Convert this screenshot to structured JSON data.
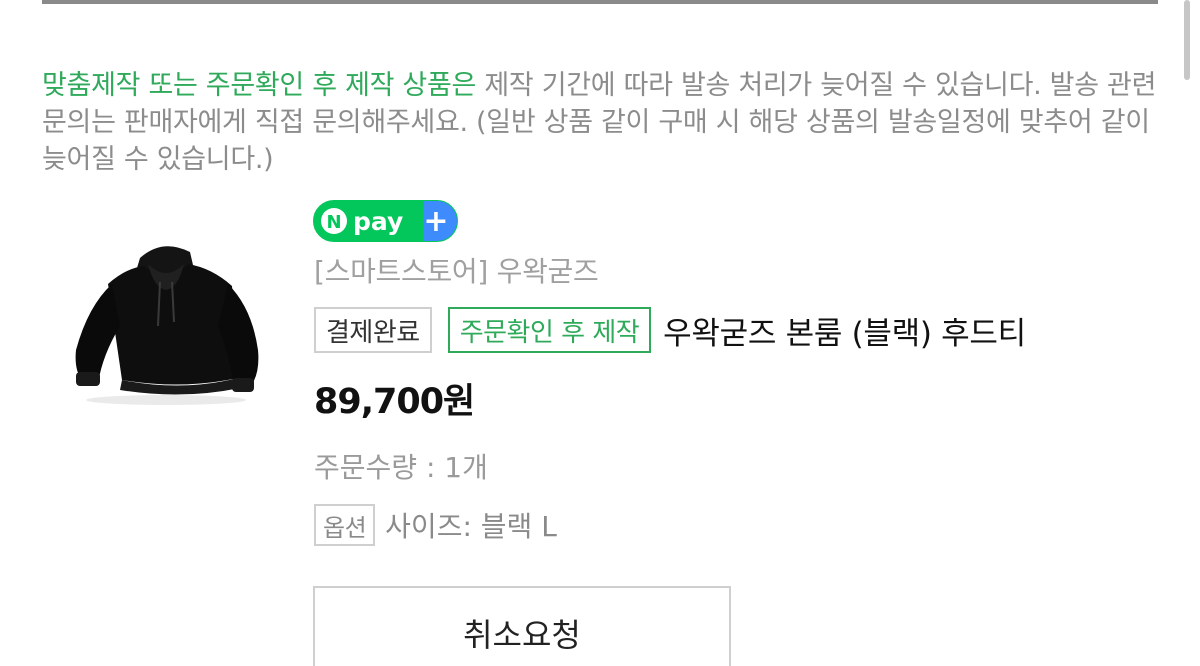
{
  "notice": {
    "highlight": "맞춤제작 또는 주문확인 후 제작 상품은",
    "body": " 제작 기간에 따라 발송 처리가 늦어질 수 있습니다. 발송 관련 문의는 판매자에게 직접 문의해주세요. (일반 상품 같이 구매 시 해당 상품의 발송일정에 맞추어 같이 늦어질 수 있습니다.)"
  },
  "order": {
    "badge": {
      "logo_letter": "N",
      "text": "pay",
      "plus": "+",
      "colors": {
        "green": "#03c75a",
        "blue": "#3d8bfd"
      }
    },
    "store": "[스마트스토어] 우왁굳즈",
    "status_tag": "결제완료",
    "made_to_order_tag": "주문확인 후 제작",
    "product_title": "우왁굳즈 본룸 (블랙) 후드티",
    "price": "89,700원",
    "quantity": "주문수량 : 1개",
    "option_label": "옵션",
    "option_value": "사이즈: 블랙 L",
    "cancel_button": "취소요청",
    "product_image_icon": "black-hoodie-image"
  },
  "colors": {
    "accent_green": "#2eaa5a",
    "muted_text": "#8c8c8c",
    "border": "#cfcfcf"
  }
}
